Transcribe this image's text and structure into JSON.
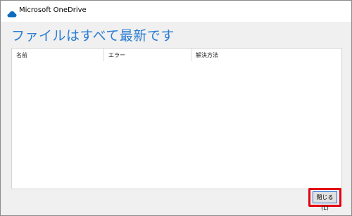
{
  "window": {
    "title": "Microsoft OneDrive",
    "app_icon": "onedrive-cloud-icon"
  },
  "main": {
    "heading": "ファイルはすべて最新です"
  },
  "table": {
    "columns": [
      "名前",
      "エラー",
      "解決方法"
    ],
    "rows": []
  },
  "footer": {
    "close_label": "閉じる(L)"
  },
  "colors": {
    "accent": "#2b7cd3",
    "onedrive_blue": "#0f6cbd",
    "highlight": "#e3000f"
  }
}
